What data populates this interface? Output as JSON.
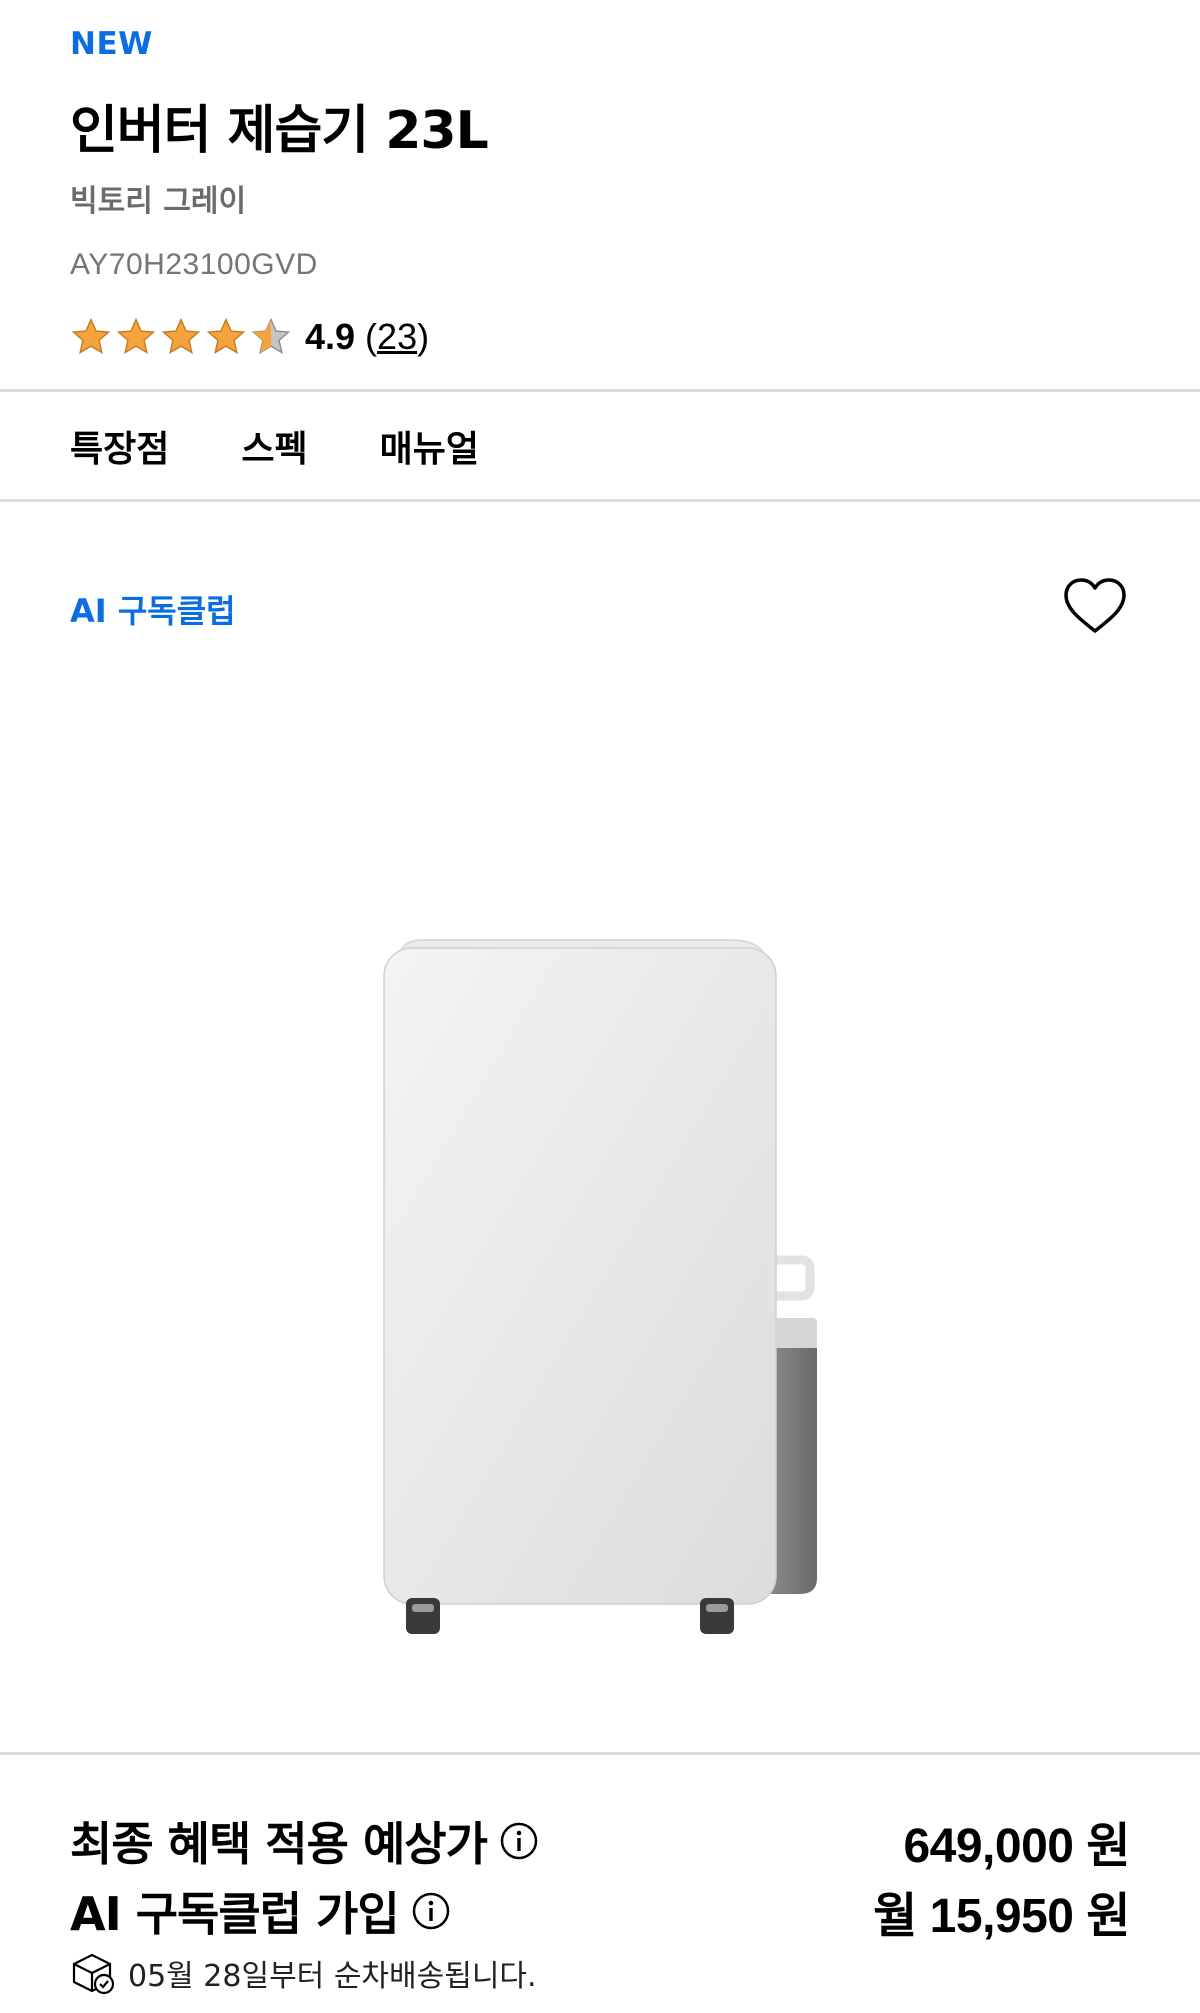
{
  "product": {
    "badge": "NEW",
    "title": "인버터 제습기 23L",
    "color_name": "빅토리 그레이",
    "model_code": "AY70H23100GVD",
    "rating_value": "4.9",
    "rating_count_open": "(",
    "rating_count": "23",
    "rating_count_close": ")",
    "rating_stars": 4.5,
    "star_color": "#f5a33c"
  },
  "tabs": [
    {
      "label": "특장점"
    },
    {
      "label": "스펙"
    },
    {
      "label": "매뉴얼"
    }
  ],
  "subscription_label": "AI 구독클럽",
  "icons": {
    "wishlist": "heart-icon",
    "info": "info-icon",
    "delivery": "delivery-box-icon"
  },
  "pricing": {
    "final_price_label": "최종 혜택 적용 예상가",
    "final_price_value": "649,000",
    "final_price_unit": "원",
    "subscription_label": "AI 구독클럽 가입",
    "subscription_prefix": "월",
    "subscription_value": "15,950",
    "subscription_unit": "원"
  },
  "delivery_text": "05월 28일부터 순차배송됩니다.",
  "colors": {
    "accent_blue": "#0b6ee0",
    "divider": "#dedede"
  }
}
